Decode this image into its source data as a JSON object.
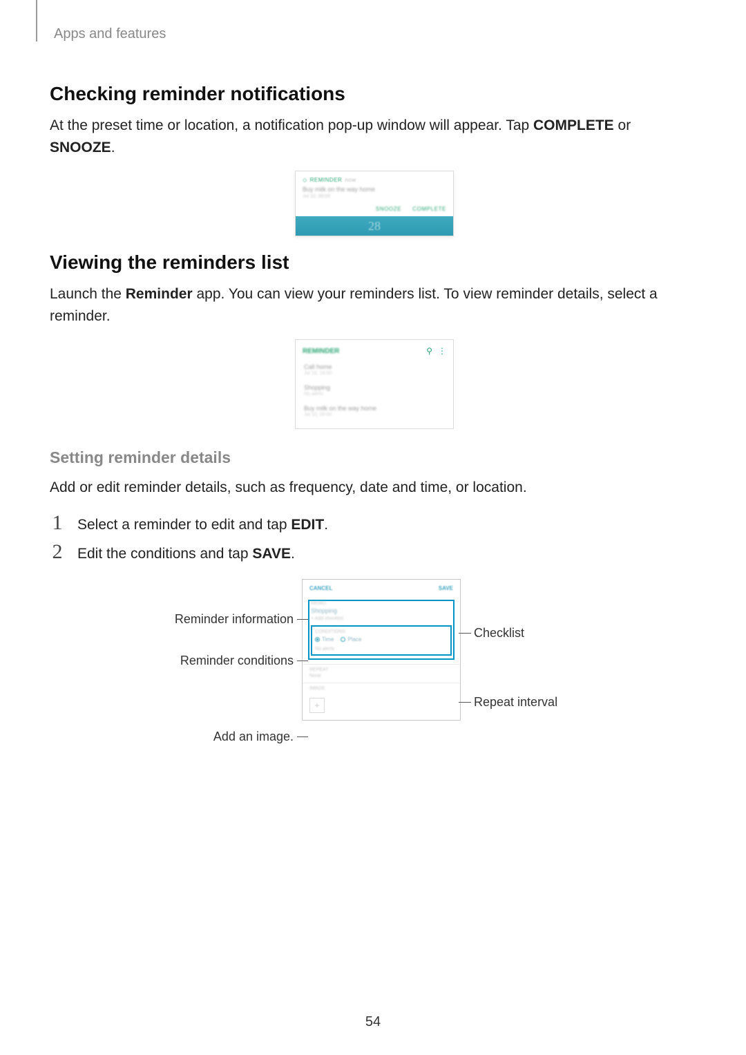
{
  "breadcrumb": "Apps and features",
  "section1": {
    "title": "Checking reminder notifications",
    "para_pre": "At the preset time or location, a notification pop-up window will appear. Tap ",
    "bold1": "COMPLETE",
    "mid": " or ",
    "bold2": "SNOOZE",
    "tail": "."
  },
  "notif": {
    "source": "REMINDER",
    "source_meta": "now",
    "title": "Buy milk on the way home",
    "sub": "Jul 10, 09:00",
    "snooze": "SNOOZE",
    "complete": "COMPLETE",
    "clock": "28"
  },
  "section2": {
    "title": "Viewing the reminders list",
    "para_pre": "Launch the ",
    "bold1": "Reminder",
    "para_post": " app. You can view your reminders list. To view reminder details, select a reminder."
  },
  "list": {
    "title": "REMINDER",
    "items": [
      {
        "title": "Call home",
        "sub": "Jul 10, 16:00"
      },
      {
        "title": "Shopping",
        "sub": "No alerts"
      },
      {
        "title": "Buy milk on the way home",
        "sub": "Jul 10, 09:00"
      }
    ]
  },
  "section3": {
    "title": "Setting reminder details",
    "para": "Add or edit reminder details, such as frequency, date and time, or location."
  },
  "steps": [
    {
      "n": "1",
      "pre": "Select a reminder to edit and tap ",
      "bold": "EDIT",
      "post": "."
    },
    {
      "n": "2",
      "pre": "Edit the conditions and tap ",
      "bold": "SAVE",
      "post": "."
    }
  ],
  "edit": {
    "cancel": "CANCEL",
    "save": "SAVE",
    "memo_label": "MEMO",
    "memo_value": "Shopping",
    "checklist_hint": "+ Add checklist",
    "conditions_label": "CONDITIONS",
    "radio_time": "Time",
    "radio_place": "Place",
    "no_alerts": "No alerts",
    "repeat_label": "REPEAT",
    "repeat_value": "None",
    "image_label": "IMAGE",
    "plus": "+"
  },
  "callouts": {
    "info": "Reminder information",
    "conditions": "Reminder conditions",
    "add_image": "Add an image.",
    "checklist": "Checklist",
    "repeat": "Repeat interval"
  },
  "page_number": "54"
}
